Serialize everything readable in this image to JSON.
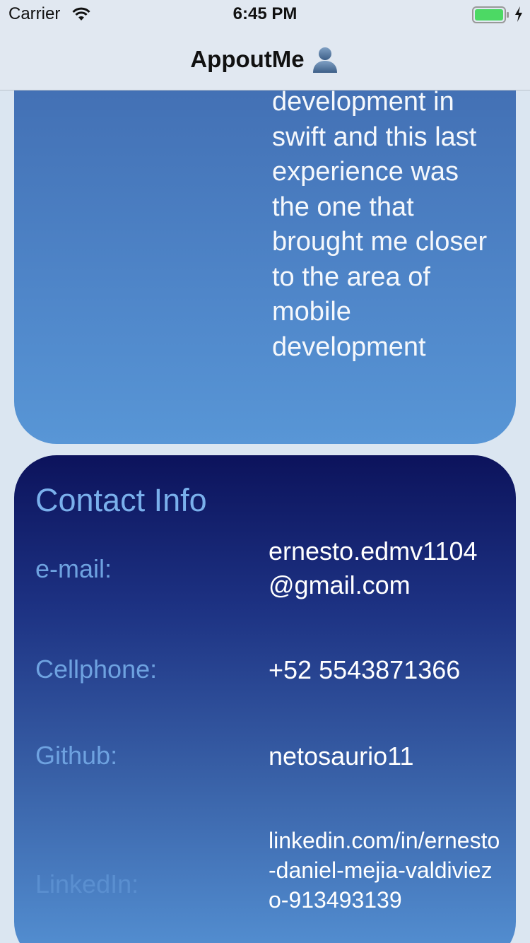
{
  "status": {
    "carrier": "Carrier",
    "time": "6:45 PM"
  },
  "nav": {
    "title": "AppoutMe",
    "icon": "person-icon"
  },
  "about": {
    "text_lines": [
      "development in",
      "swift and this last",
      "experience was",
      "the one that",
      "brought me closer",
      "to the area of",
      "mobile",
      "development"
    ]
  },
  "contact": {
    "title": "Contact Info",
    "email_label": "e-mail:",
    "email_value": "ernesto.edmv1104@gmail.com",
    "phone_label": "Cellphone:",
    "phone_value": "+52 5543871366",
    "github_label": "Github:",
    "github_value": "netosaurio11",
    "linkedin_label": "LinkedIn:",
    "linkedin_value": "linkedin.com/in/ernesto-daniel-mejia-valdiviezo-913493139"
  },
  "colors": {
    "accent": "#7ab0ec",
    "battery": "#4cd964"
  }
}
